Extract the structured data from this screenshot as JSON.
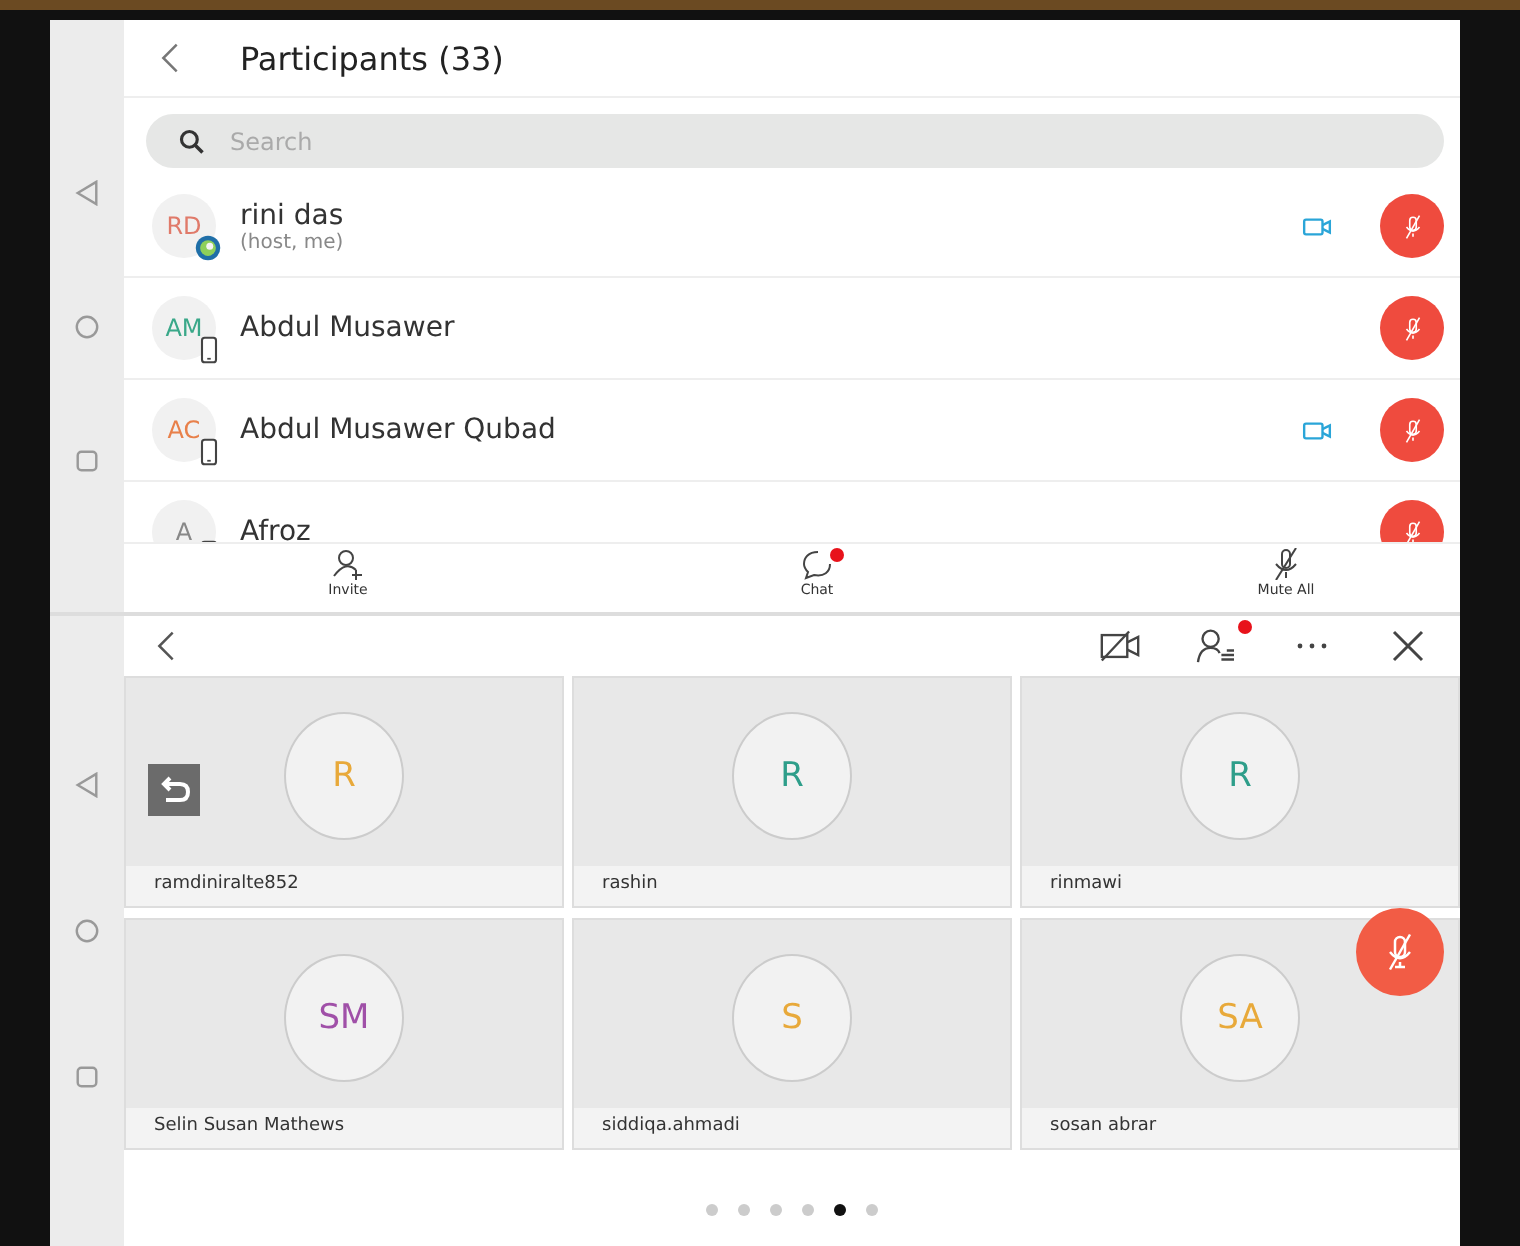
{
  "participants_panel": {
    "title": "Participants (33)",
    "search": {
      "placeholder": "Search"
    },
    "participants": [
      {
        "initials": "RD",
        "color": "#e07a6a",
        "kind": "web",
        "name": "rini das",
        "role": "(host, me)",
        "video": true,
        "muted": true
      },
      {
        "initials": "AM",
        "color": "#3aa889",
        "kind": "phone",
        "name": "Abdul Musawer",
        "video": false,
        "muted": true
      },
      {
        "initials": "AC",
        "color": "#e8804a",
        "kind": "phone",
        "name": "Abdul Musawer Qubad",
        "video": true,
        "muted": true
      },
      {
        "initials": "A",
        "color": "#888888",
        "kind": "phone",
        "name": "Afroz",
        "video": false,
        "muted": true
      }
    ],
    "toolbar": [
      {
        "kind": "invite",
        "label": "Invite",
        "notification": false
      },
      {
        "kind": "chat",
        "label": "Chat",
        "notification": true
      },
      {
        "kind": "mute",
        "label": "Mute All",
        "notification": false
      }
    ]
  },
  "video_panel": {
    "participants_notification": true,
    "tiles": [
      {
        "initials": "R",
        "color": "#e8a93a",
        "name": "ramdiniralte852"
      },
      {
        "initials": "R",
        "color": "#2e9e8a",
        "name": "rashin"
      },
      {
        "initials": "R",
        "color": "#2e9e8a",
        "name": "rinmawi"
      },
      {
        "initials": "SM",
        "color": "#a050a8",
        "name": "Selin Susan Mathews"
      },
      {
        "initials": "S",
        "color": "#e8a93a",
        "name": "siddiqa.ahmadi"
      },
      {
        "initials": "SA",
        "color": "#e8a93a",
        "name": "sosan abrar"
      }
    ],
    "pages": [
      {
        "selected": false
      },
      {
        "selected": false
      },
      {
        "selected": false
      },
      {
        "selected": false
      },
      {
        "selected": true
      },
      {
        "selected": false
      }
    ]
  }
}
